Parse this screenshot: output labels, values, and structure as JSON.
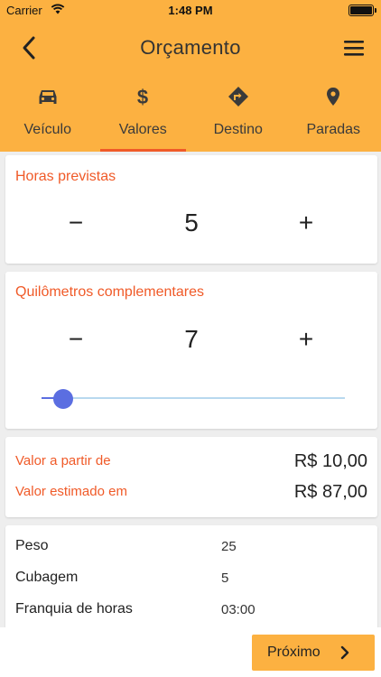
{
  "status_bar": {
    "carrier": "Carrier",
    "time": "1:48 PM"
  },
  "nav": {
    "title": "Orçamento"
  },
  "tabs": [
    {
      "label": "Veículo",
      "icon": "car-icon"
    },
    {
      "label": "Valores",
      "icon": "dollar-icon"
    },
    {
      "label": "Destino",
      "icon": "directions-icon"
    },
    {
      "label": "Paradas",
      "icon": "location-pin-icon"
    }
  ],
  "hours_card": {
    "title": "Horas previstas",
    "minus": "−",
    "value": "5",
    "plus": "+"
  },
  "km_card": {
    "title": "Quilômetros complementares",
    "minus": "−",
    "value": "7",
    "plus": "+",
    "slider_fraction": 0.07
  },
  "prices": {
    "from_label": "Valor a partir de",
    "from_value": "R$ 10,00",
    "estimated_label": "Valor estimado em",
    "estimated_value": "R$ 87,00"
  },
  "info": [
    {
      "label": "Peso",
      "value": "25"
    },
    {
      "label": "Cubagem",
      "value": "5"
    },
    {
      "label": "Franquia de horas",
      "value": "03:00"
    }
  ],
  "footer": {
    "next_label": "Próximo"
  },
  "colors": {
    "header": "#fcb141",
    "accent": "#f05a28",
    "slider": "#5b6ee1"
  }
}
